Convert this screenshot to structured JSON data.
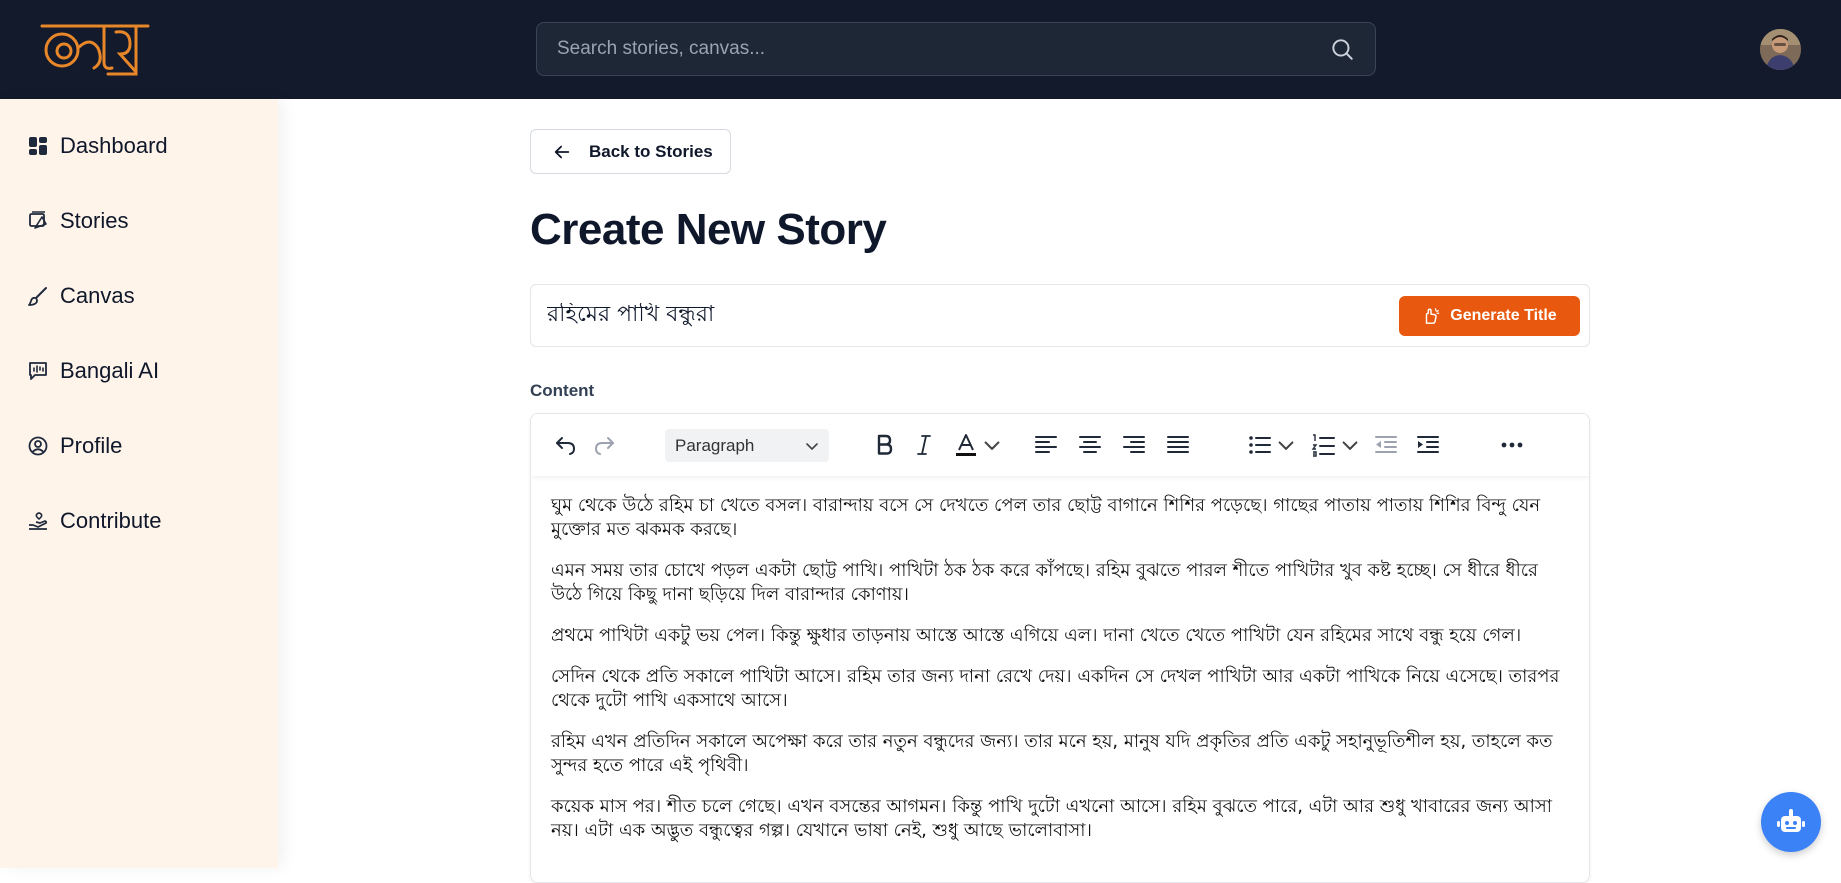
{
  "header": {
    "logo_alt": "অক্ষর",
    "search_placeholder": "Search stories, canvas..."
  },
  "sidebar": {
    "items": [
      {
        "label": "Dashboard",
        "icon": "dashboard-icon"
      },
      {
        "label": "Stories",
        "icon": "stories-icon"
      },
      {
        "label": "Canvas",
        "icon": "brush-icon"
      },
      {
        "label": "Bangali AI",
        "icon": "ai-chat-icon"
      },
      {
        "label": "Profile",
        "icon": "user-circle-icon"
      },
      {
        "label": "Contribute",
        "icon": "contribute-icon"
      }
    ]
  },
  "main": {
    "back_label": "Back to Stories",
    "page_title": "Create New Story",
    "story_title_value": "রহিমের পাখি বন্ধুরা",
    "generate_title_label": "Generate Title",
    "content_label": "Content",
    "editor": {
      "block_format": "Paragraph",
      "paragraphs": [
        "ঘুম থেকে উঠে রহিম চা খেতে বসল। বারান্দায় বসে সে দেখতে পেল তার ছোট্ট বাগানে শিশির পড়েছে। গাছের পাতায় পাতায় শিশির বিন্দু যেন মুক্তোর মত ঝকমক করছে।",
        "এমন সময় তার চোখে পড়ল একটা ছোট্ট পাখি। পাখিটা ঠক ঠক করে কাঁপছে। রহিম বুঝতে পারল শীতে পাখিটার খুব কষ্ট হচ্ছে। সে ধীরে ধীরে উঠে গিয়ে কিছু দানা ছড়িয়ে দিল বারান্দার কোণায়।",
        "প্রথমে পাখিটা একটু ভয় পেল। কিন্তু ক্ষুধার তাড়নায় আস্তে আস্তে এগিয়ে এল। দানা খেতে খেতে পাখিটা যেন রহিমের সাথে বন্ধু হয়ে গেল।",
        "সেদিন থেকে প্রতি সকালে পাখিটা আসে। রহিম তার জন্য দানা রেখে দেয়। একদিন সে দেখল পাখিটা আর একটা পাখিকে নিয়ে এসেছে। তারপর থেকে দুটো পাখি একসাথে আসে।",
        "রহিম এখন প্রতিদিন সকালে অপেক্ষা করে তার নতুন বন্ধুদের জন্য। তার মনে হয়, মানুষ যদি প্রকৃতির প্রতি একটু সহানুভূতিশীল হয়, তাহলে কত সুন্দর হতে পারে এই পৃথিবী।",
        "কয়েক মাস পর। শীত চলে গেছে। এখন বসন্তের আগমন। কিন্তু পাখি দুটো এখনো আসে। রহিম বুঝতে পারে, এটা আর শুধু খাবারের জন্য আসা নয়। এটা এক অদ্ভুত বন্ধুত্বের গল্প। যেখানে ভাষা নেই, শুধু আছে ভালোবাসা।"
      ]
    }
  },
  "colors": {
    "topbar": "#121a2b",
    "sidebar": "#fff4ea",
    "accent": "#e8580f",
    "bot": "#3b82f6"
  }
}
